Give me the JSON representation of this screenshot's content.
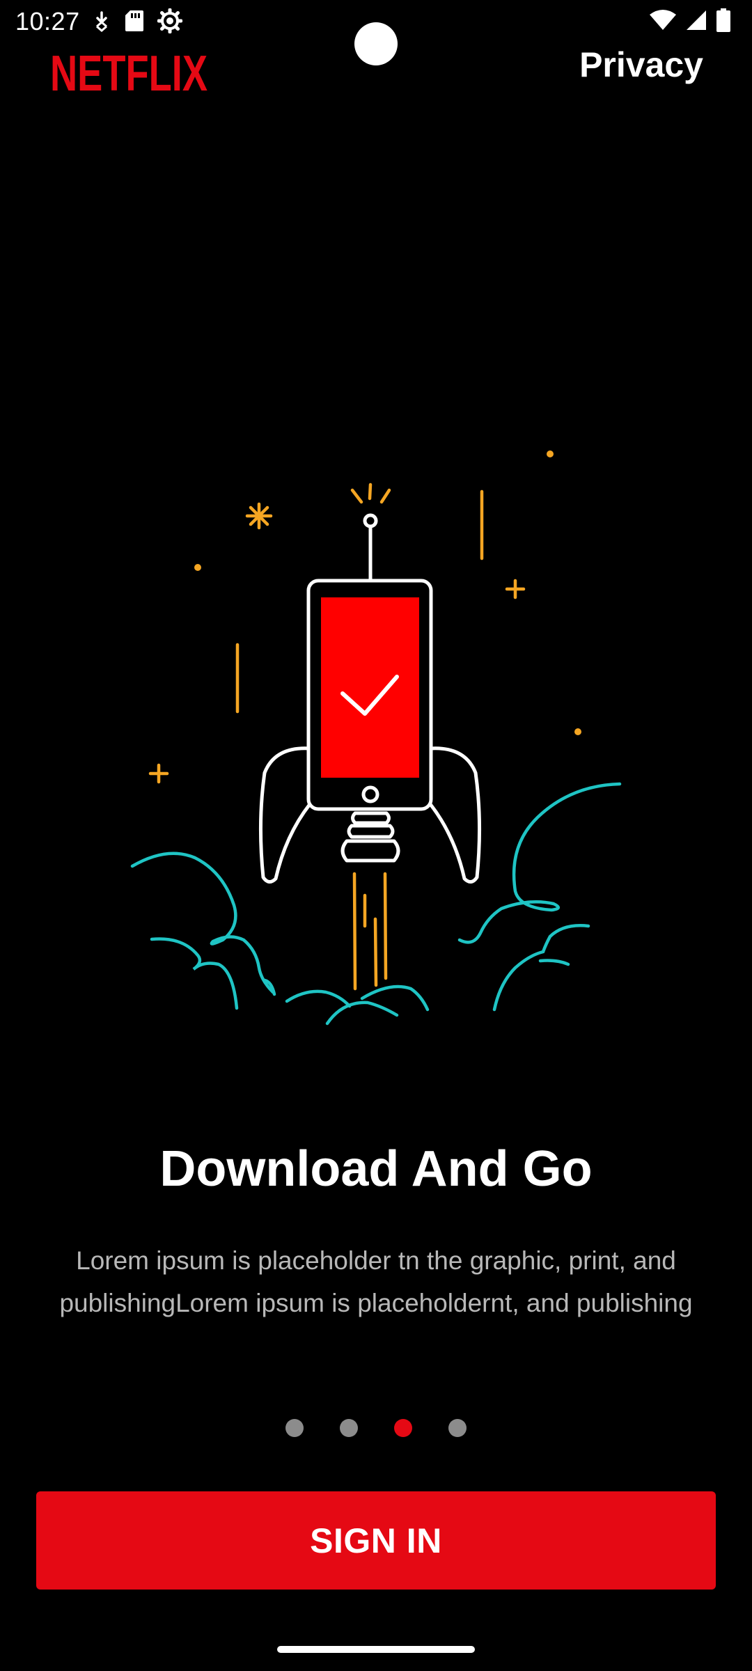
{
  "status_bar": {
    "time": "10:27",
    "left_icons": [
      "download-notification-icon",
      "sd-card-icon",
      "settings-gear-icon"
    ],
    "right_icons": [
      "wifi-icon",
      "signal-icon",
      "battery-icon"
    ]
  },
  "header": {
    "logo_text": "NETFLIX",
    "privacy_label": "Privacy"
  },
  "onboarding": {
    "illustration": "rocket-phone-launch-illustration",
    "title": "Download And Go",
    "description": "Lorem ipsum is placeholder tn the graphic, print, and publishingLorem ipsum is placeholdernt, and publishing",
    "page_count": 4,
    "active_page": 3
  },
  "actions": {
    "sign_in_label": "SIGN IN"
  },
  "colors": {
    "brand_red": "#e50914",
    "background": "#000000",
    "dot_inactive": "#8c8c8c",
    "illustration_orange": "#f5a623",
    "illustration_teal": "#1fc4c4"
  }
}
